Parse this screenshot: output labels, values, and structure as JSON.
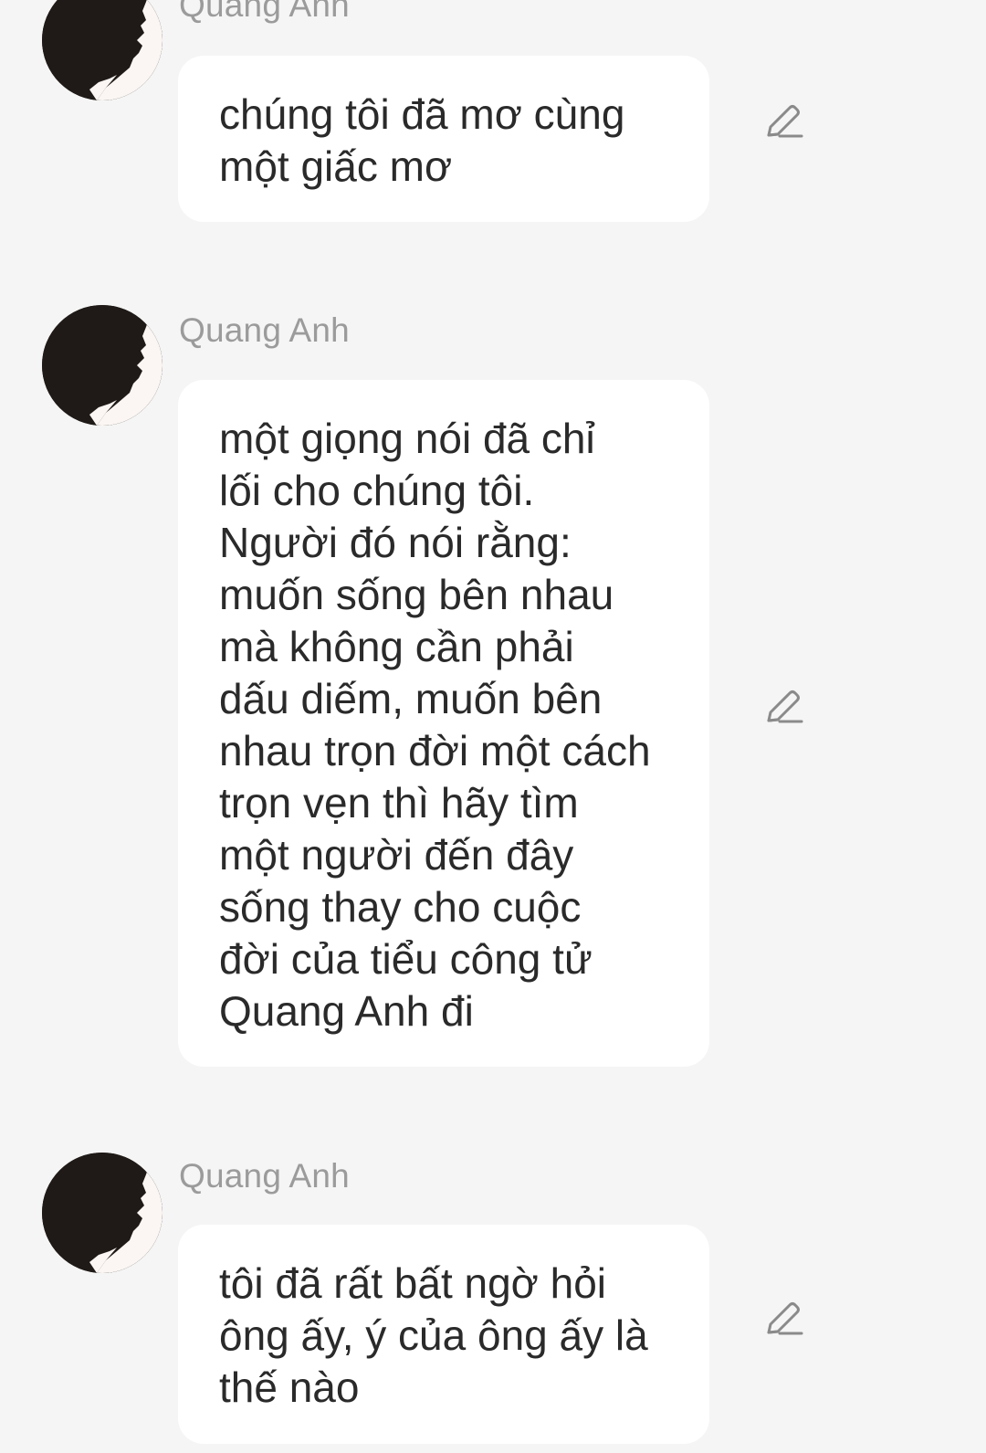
{
  "messages": [
    {
      "sender": "Quang Anh",
      "text": "chúng tôi đã mơ cùng\nmột giấc mơ"
    },
    {
      "sender": "Quang Anh",
      "text": "một giọng nói đã chỉ\nlối cho chúng tôi.\nNgười đó nói rằng:\nmuốn sống bên nhau\nmà không cần phải\ndấu diếm, muốn bên\nnhau trọn đời một cách\ntrọn vẹn thì hãy tìm\nmột người đến đây\nsống thay cho cuộc\nđời của tiểu công tử\nQuang Anh đi"
    },
    {
      "sender": "Quang Anh",
      "text": "tôi đã rất bất ngờ hỏi\nông ấy, ý của ông ấy là\nthế nào"
    }
  ],
  "icons": {
    "avatar": "silhouette-avatar",
    "edit": "pencil-edit-icon"
  },
  "colors": {
    "background": "#f5f5f5",
    "bubble": "#ffffff",
    "sender_name": "#9b9b9b",
    "message_text": "#2a2a2a",
    "icon": "#8a8a8a"
  }
}
